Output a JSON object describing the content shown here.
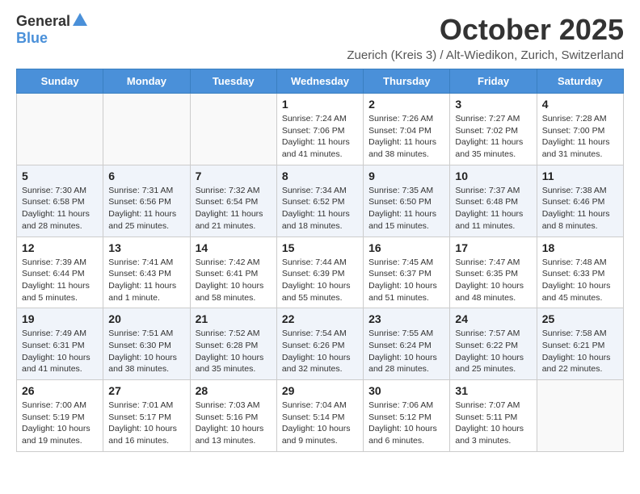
{
  "header": {
    "logo_general": "General",
    "logo_blue": "Blue",
    "month_title": "October 2025",
    "location": "Zuerich (Kreis 3) / Alt-Wiedikon, Zurich, Switzerland"
  },
  "calendar": {
    "days_of_week": [
      "Sunday",
      "Monday",
      "Tuesday",
      "Wednesday",
      "Thursday",
      "Friday",
      "Saturday"
    ],
    "weeks": [
      {
        "alt": false,
        "days": [
          {
            "num": "",
            "info": ""
          },
          {
            "num": "",
            "info": ""
          },
          {
            "num": "",
            "info": ""
          },
          {
            "num": "1",
            "info": "Sunrise: 7:24 AM\nSunset: 7:06 PM\nDaylight: 11 hours and 41 minutes."
          },
          {
            "num": "2",
            "info": "Sunrise: 7:26 AM\nSunset: 7:04 PM\nDaylight: 11 hours and 38 minutes."
          },
          {
            "num": "3",
            "info": "Sunrise: 7:27 AM\nSunset: 7:02 PM\nDaylight: 11 hours and 35 minutes."
          },
          {
            "num": "4",
            "info": "Sunrise: 7:28 AM\nSunset: 7:00 PM\nDaylight: 11 hours and 31 minutes."
          }
        ]
      },
      {
        "alt": true,
        "days": [
          {
            "num": "5",
            "info": "Sunrise: 7:30 AM\nSunset: 6:58 PM\nDaylight: 11 hours and 28 minutes."
          },
          {
            "num": "6",
            "info": "Sunrise: 7:31 AM\nSunset: 6:56 PM\nDaylight: 11 hours and 25 minutes."
          },
          {
            "num": "7",
            "info": "Sunrise: 7:32 AM\nSunset: 6:54 PM\nDaylight: 11 hours and 21 minutes."
          },
          {
            "num": "8",
            "info": "Sunrise: 7:34 AM\nSunset: 6:52 PM\nDaylight: 11 hours and 18 minutes."
          },
          {
            "num": "9",
            "info": "Sunrise: 7:35 AM\nSunset: 6:50 PM\nDaylight: 11 hours and 15 minutes."
          },
          {
            "num": "10",
            "info": "Sunrise: 7:37 AM\nSunset: 6:48 PM\nDaylight: 11 hours and 11 minutes."
          },
          {
            "num": "11",
            "info": "Sunrise: 7:38 AM\nSunset: 6:46 PM\nDaylight: 11 hours and 8 minutes."
          }
        ]
      },
      {
        "alt": false,
        "days": [
          {
            "num": "12",
            "info": "Sunrise: 7:39 AM\nSunset: 6:44 PM\nDaylight: 11 hours and 5 minutes."
          },
          {
            "num": "13",
            "info": "Sunrise: 7:41 AM\nSunset: 6:43 PM\nDaylight: 11 hours and 1 minute."
          },
          {
            "num": "14",
            "info": "Sunrise: 7:42 AM\nSunset: 6:41 PM\nDaylight: 10 hours and 58 minutes."
          },
          {
            "num": "15",
            "info": "Sunrise: 7:44 AM\nSunset: 6:39 PM\nDaylight: 10 hours and 55 minutes."
          },
          {
            "num": "16",
            "info": "Sunrise: 7:45 AM\nSunset: 6:37 PM\nDaylight: 10 hours and 51 minutes."
          },
          {
            "num": "17",
            "info": "Sunrise: 7:47 AM\nSunset: 6:35 PM\nDaylight: 10 hours and 48 minutes."
          },
          {
            "num": "18",
            "info": "Sunrise: 7:48 AM\nSunset: 6:33 PM\nDaylight: 10 hours and 45 minutes."
          }
        ]
      },
      {
        "alt": true,
        "days": [
          {
            "num": "19",
            "info": "Sunrise: 7:49 AM\nSunset: 6:31 PM\nDaylight: 10 hours and 41 minutes."
          },
          {
            "num": "20",
            "info": "Sunrise: 7:51 AM\nSunset: 6:30 PM\nDaylight: 10 hours and 38 minutes."
          },
          {
            "num": "21",
            "info": "Sunrise: 7:52 AM\nSunset: 6:28 PM\nDaylight: 10 hours and 35 minutes."
          },
          {
            "num": "22",
            "info": "Sunrise: 7:54 AM\nSunset: 6:26 PM\nDaylight: 10 hours and 32 minutes."
          },
          {
            "num": "23",
            "info": "Sunrise: 7:55 AM\nSunset: 6:24 PM\nDaylight: 10 hours and 28 minutes."
          },
          {
            "num": "24",
            "info": "Sunrise: 7:57 AM\nSunset: 6:22 PM\nDaylight: 10 hours and 25 minutes."
          },
          {
            "num": "25",
            "info": "Sunrise: 7:58 AM\nSunset: 6:21 PM\nDaylight: 10 hours and 22 minutes."
          }
        ]
      },
      {
        "alt": false,
        "days": [
          {
            "num": "26",
            "info": "Sunrise: 7:00 AM\nSunset: 5:19 PM\nDaylight: 10 hours and 19 minutes."
          },
          {
            "num": "27",
            "info": "Sunrise: 7:01 AM\nSunset: 5:17 PM\nDaylight: 10 hours and 16 minutes."
          },
          {
            "num": "28",
            "info": "Sunrise: 7:03 AM\nSunset: 5:16 PM\nDaylight: 10 hours and 13 minutes."
          },
          {
            "num": "29",
            "info": "Sunrise: 7:04 AM\nSunset: 5:14 PM\nDaylight: 10 hours and 9 minutes."
          },
          {
            "num": "30",
            "info": "Sunrise: 7:06 AM\nSunset: 5:12 PM\nDaylight: 10 hours and 6 minutes."
          },
          {
            "num": "31",
            "info": "Sunrise: 7:07 AM\nSunset: 5:11 PM\nDaylight: 10 hours and 3 minutes."
          },
          {
            "num": "",
            "info": ""
          }
        ]
      }
    ]
  }
}
